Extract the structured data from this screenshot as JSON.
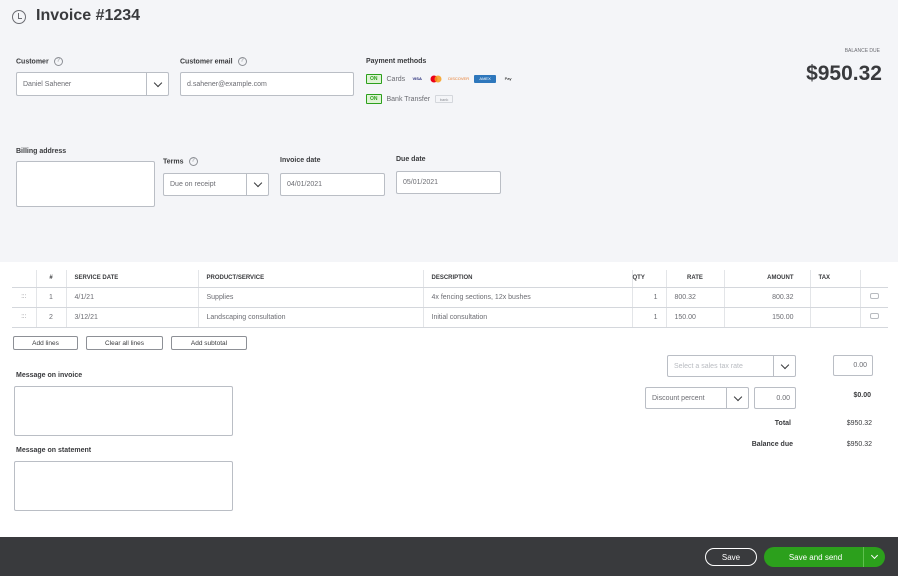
{
  "header": {
    "title": "Invoice #1234"
  },
  "customer": {
    "label": "Customer",
    "value": "Daniel Sahener"
  },
  "email": {
    "label": "Customer email",
    "value": "d.sahener@example.com"
  },
  "payment": {
    "label": "Payment methods",
    "on_label": "ON",
    "cards_label": "Cards",
    "card_logos": [
      "VISA",
      "MC",
      "DISCOVER",
      "AMEX",
      "Pay"
    ],
    "bank_label": "Bank Transfer",
    "bank_logo": "bank"
  },
  "balance": {
    "label": "BALANCE DUE",
    "amount": "$950.32"
  },
  "billing": {
    "label": "Billing address",
    "value": ""
  },
  "terms": {
    "label": "Terms",
    "value": "Due on receipt"
  },
  "invoice_date": {
    "label": "Invoice date",
    "value": "04/01/2021"
  },
  "due_date": {
    "label": "Due date",
    "value": "05/01/2021"
  },
  "lines": {
    "headers": [
      "#",
      "SERVICE DATE",
      "PRODUCT/SERVICE",
      "DESCRIPTION",
      "QTY",
      "RATE",
      "AMOUNT",
      "TAX"
    ],
    "rows": [
      {
        "no": "1",
        "date": "4/1/21",
        "product": "Supplies",
        "description": "4x fencing sections, 12x bushes",
        "qty": "1",
        "rate": "800.32",
        "amount": "800.32"
      },
      {
        "no": "2",
        "date": "3/12/21",
        "product": "Landscaping consultation",
        "description": "Initial consultation",
        "qty": "1",
        "rate": "150.00",
        "amount": "150.00"
      }
    ]
  },
  "buttons": {
    "add_lines": "Add lines",
    "clear_lines": "Clear all lines",
    "add_subtotal": "Add subtotal"
  },
  "messages": {
    "invoice_label": "Message on invoice",
    "statement_label": "Message on statement"
  },
  "totals": {
    "tax_select_placeholder": "Select a sales tax rate",
    "tax_value": "0.00",
    "discount_type": "Discount percent",
    "discount_input": "0.00",
    "discount_amount": "$0.00",
    "total_label": "Total",
    "total_value": "$950.32",
    "balance_label": "Balance due",
    "balance_value": "$950.32"
  },
  "footer": {
    "save": "Save",
    "save_send": "Save and send"
  },
  "colors": {
    "brand_green": "#2ca01c",
    "footer_bg": "#393a3d",
    "header_bg": "#f4f5f8"
  }
}
